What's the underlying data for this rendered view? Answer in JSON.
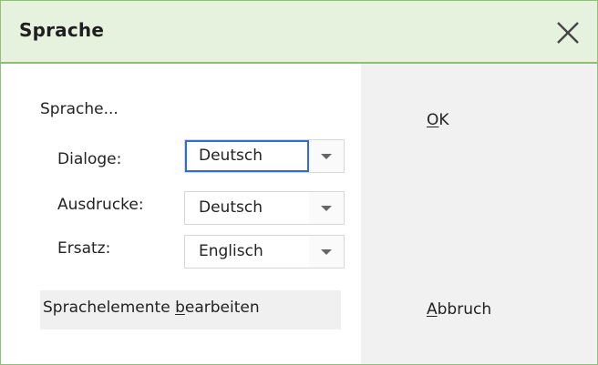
{
  "dialog": {
    "title": "Sprache",
    "close_icon": "close-x-icon",
    "accent_color": "#89c06f",
    "title_bg": "#e6f1de"
  },
  "language": {
    "section_label": "Sprache...",
    "rows": [
      {
        "label": "Dialoge:",
        "value": "Deutsch",
        "focused": true
      },
      {
        "label": "Ausdrucke:",
        "value": "Deutsch",
        "focused": false
      },
      {
        "label": "Ersatz:",
        "value": "Englisch",
        "focused": false
      }
    ],
    "edit_button": {
      "prefix": "Sprachelemente ",
      "mnemonic": "b",
      "suffix": "earbeiten"
    }
  },
  "actions": {
    "ok": {
      "mnemonic": "O",
      "rest": "K"
    },
    "cancel": {
      "mnemonic": "A",
      "rest": "bbruch"
    }
  }
}
